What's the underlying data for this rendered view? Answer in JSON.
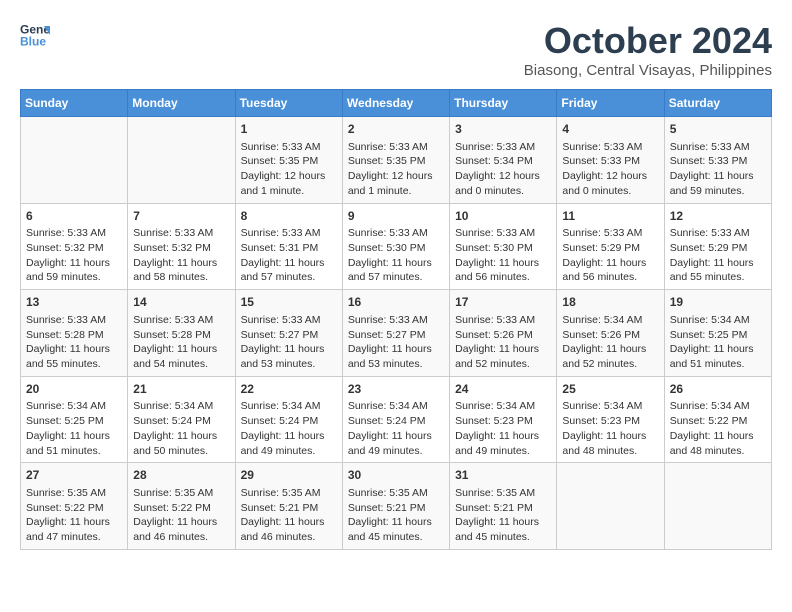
{
  "header": {
    "logo_line1": "General",
    "logo_line2": "Blue",
    "month": "October 2024",
    "location": "Biasong, Central Visayas, Philippines"
  },
  "weekdays": [
    "Sunday",
    "Monday",
    "Tuesday",
    "Wednesday",
    "Thursday",
    "Friday",
    "Saturday"
  ],
  "weeks": [
    [
      {
        "day": "",
        "info": ""
      },
      {
        "day": "",
        "info": ""
      },
      {
        "day": "1",
        "info": "Sunrise: 5:33 AM\nSunset: 5:35 PM\nDaylight: 12 hours\nand 1 minute."
      },
      {
        "day": "2",
        "info": "Sunrise: 5:33 AM\nSunset: 5:35 PM\nDaylight: 12 hours\nand 1 minute."
      },
      {
        "day": "3",
        "info": "Sunrise: 5:33 AM\nSunset: 5:34 PM\nDaylight: 12 hours\nand 0 minutes."
      },
      {
        "day": "4",
        "info": "Sunrise: 5:33 AM\nSunset: 5:33 PM\nDaylight: 12 hours\nand 0 minutes."
      },
      {
        "day": "5",
        "info": "Sunrise: 5:33 AM\nSunset: 5:33 PM\nDaylight: 11 hours\nand 59 minutes."
      }
    ],
    [
      {
        "day": "6",
        "info": "Sunrise: 5:33 AM\nSunset: 5:32 PM\nDaylight: 11 hours\nand 59 minutes."
      },
      {
        "day": "7",
        "info": "Sunrise: 5:33 AM\nSunset: 5:32 PM\nDaylight: 11 hours\nand 58 minutes."
      },
      {
        "day": "8",
        "info": "Sunrise: 5:33 AM\nSunset: 5:31 PM\nDaylight: 11 hours\nand 57 minutes."
      },
      {
        "day": "9",
        "info": "Sunrise: 5:33 AM\nSunset: 5:30 PM\nDaylight: 11 hours\nand 57 minutes."
      },
      {
        "day": "10",
        "info": "Sunrise: 5:33 AM\nSunset: 5:30 PM\nDaylight: 11 hours\nand 56 minutes."
      },
      {
        "day": "11",
        "info": "Sunrise: 5:33 AM\nSunset: 5:29 PM\nDaylight: 11 hours\nand 56 minutes."
      },
      {
        "day": "12",
        "info": "Sunrise: 5:33 AM\nSunset: 5:29 PM\nDaylight: 11 hours\nand 55 minutes."
      }
    ],
    [
      {
        "day": "13",
        "info": "Sunrise: 5:33 AM\nSunset: 5:28 PM\nDaylight: 11 hours\nand 55 minutes."
      },
      {
        "day": "14",
        "info": "Sunrise: 5:33 AM\nSunset: 5:28 PM\nDaylight: 11 hours\nand 54 minutes."
      },
      {
        "day": "15",
        "info": "Sunrise: 5:33 AM\nSunset: 5:27 PM\nDaylight: 11 hours\nand 53 minutes."
      },
      {
        "day": "16",
        "info": "Sunrise: 5:33 AM\nSunset: 5:27 PM\nDaylight: 11 hours\nand 53 minutes."
      },
      {
        "day": "17",
        "info": "Sunrise: 5:33 AM\nSunset: 5:26 PM\nDaylight: 11 hours\nand 52 minutes."
      },
      {
        "day": "18",
        "info": "Sunrise: 5:34 AM\nSunset: 5:26 PM\nDaylight: 11 hours\nand 52 minutes."
      },
      {
        "day": "19",
        "info": "Sunrise: 5:34 AM\nSunset: 5:25 PM\nDaylight: 11 hours\nand 51 minutes."
      }
    ],
    [
      {
        "day": "20",
        "info": "Sunrise: 5:34 AM\nSunset: 5:25 PM\nDaylight: 11 hours\nand 51 minutes."
      },
      {
        "day": "21",
        "info": "Sunrise: 5:34 AM\nSunset: 5:24 PM\nDaylight: 11 hours\nand 50 minutes."
      },
      {
        "day": "22",
        "info": "Sunrise: 5:34 AM\nSunset: 5:24 PM\nDaylight: 11 hours\nand 49 minutes."
      },
      {
        "day": "23",
        "info": "Sunrise: 5:34 AM\nSunset: 5:24 PM\nDaylight: 11 hours\nand 49 minutes."
      },
      {
        "day": "24",
        "info": "Sunrise: 5:34 AM\nSunset: 5:23 PM\nDaylight: 11 hours\nand 49 minutes."
      },
      {
        "day": "25",
        "info": "Sunrise: 5:34 AM\nSunset: 5:23 PM\nDaylight: 11 hours\nand 48 minutes."
      },
      {
        "day": "26",
        "info": "Sunrise: 5:34 AM\nSunset: 5:22 PM\nDaylight: 11 hours\nand 48 minutes."
      }
    ],
    [
      {
        "day": "27",
        "info": "Sunrise: 5:35 AM\nSunset: 5:22 PM\nDaylight: 11 hours\nand 47 minutes."
      },
      {
        "day": "28",
        "info": "Sunrise: 5:35 AM\nSunset: 5:22 PM\nDaylight: 11 hours\nand 46 minutes."
      },
      {
        "day": "29",
        "info": "Sunrise: 5:35 AM\nSunset: 5:21 PM\nDaylight: 11 hours\nand 46 minutes."
      },
      {
        "day": "30",
        "info": "Sunrise: 5:35 AM\nSunset: 5:21 PM\nDaylight: 11 hours\nand 45 minutes."
      },
      {
        "day": "31",
        "info": "Sunrise: 5:35 AM\nSunset: 5:21 PM\nDaylight: 11 hours\nand 45 minutes."
      },
      {
        "day": "",
        "info": ""
      },
      {
        "day": "",
        "info": ""
      }
    ]
  ]
}
